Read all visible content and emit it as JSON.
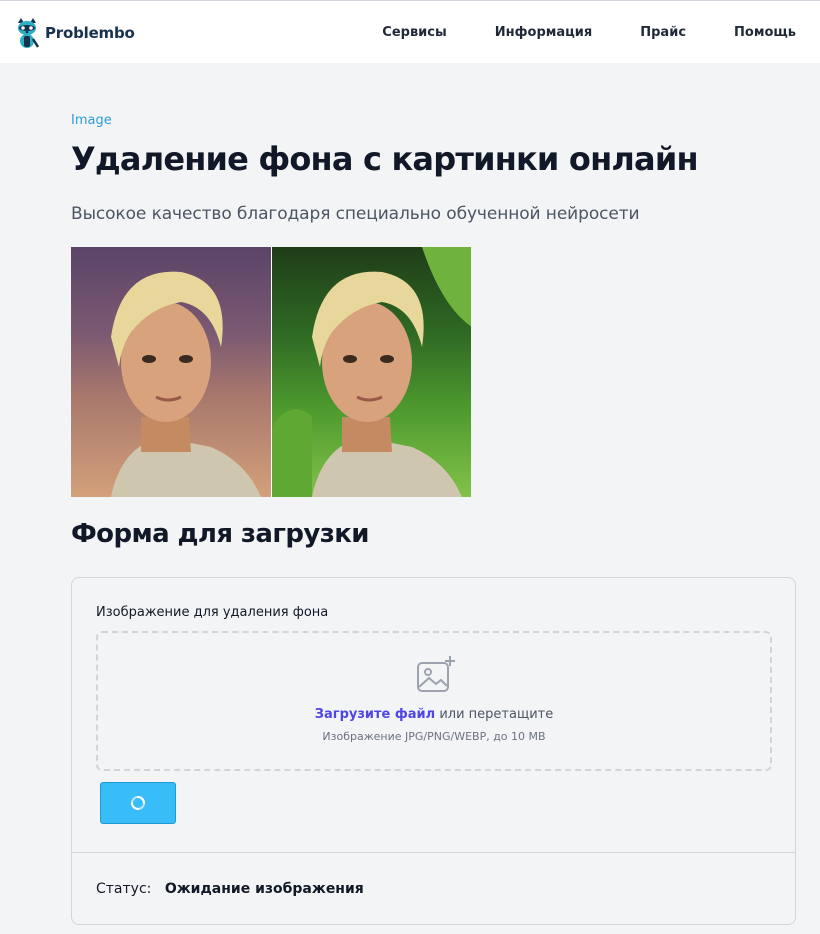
{
  "header": {
    "brand": "Problembo",
    "nav": [
      "Сервисы",
      "Информация",
      "Прайс",
      "Помощь"
    ]
  },
  "main": {
    "category": "Image",
    "title": "Удаление фона с картинки онлайн",
    "subtitle": "Высокое качество благодаря специально обученной нейросети",
    "section_title": "Форма для загрузки"
  },
  "form": {
    "field_label": "Изображение для удаления фона",
    "upload_link": "Загрузите файл",
    "upload_rest": " или перетащите",
    "hint": "Изображение JPG/PNG/WEBP, до 10 MB",
    "status_label": "Статус:",
    "status_value": "Ожидание изображения"
  },
  "icons": {
    "logo": "raccoon-logo-icon",
    "upload": "image-add-icon",
    "button": "spinner-icon"
  },
  "colors": {
    "accent_link": "#2d9cdb",
    "upload_link": "#4f46e5",
    "button": "#38bdf8",
    "brand_text": "#16324f"
  }
}
